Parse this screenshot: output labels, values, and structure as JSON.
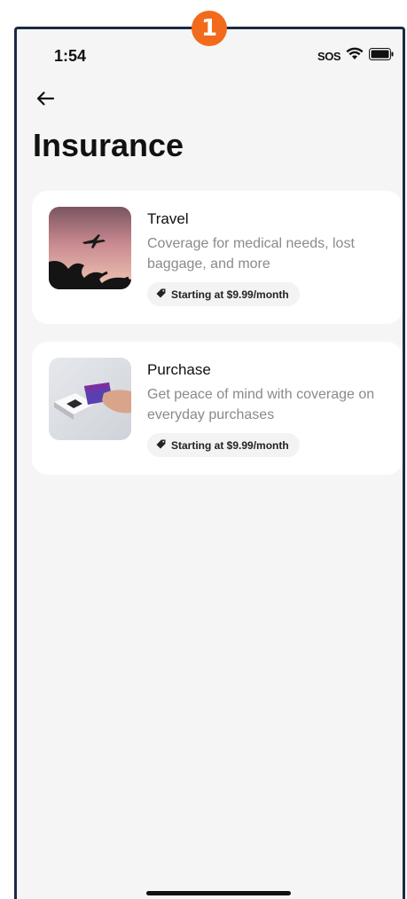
{
  "step_badge": "1",
  "status_bar": {
    "time": "1:54",
    "sos": "SOS",
    "icons": [
      "wifi-icon",
      "battery-icon"
    ]
  },
  "header": {
    "back_icon": "back-arrow-icon",
    "title": "Insurance"
  },
  "cards": [
    {
      "title": "Travel",
      "description": "Coverage for medical needs, lost baggage, and more",
      "price": "Starting at $9.99/month",
      "image": "airplane-sunset-image"
    },
    {
      "title": "Purchase",
      "description": "Get peace of mind with coverage on everyday purchases",
      "price": "Starting at $9.99/month",
      "image": "card-payment-terminal-image"
    }
  ],
  "colors": {
    "background": "#f5f5f5",
    "card": "#ffffff",
    "badge": "#f26a1b",
    "frame": "#1b2a44"
  }
}
